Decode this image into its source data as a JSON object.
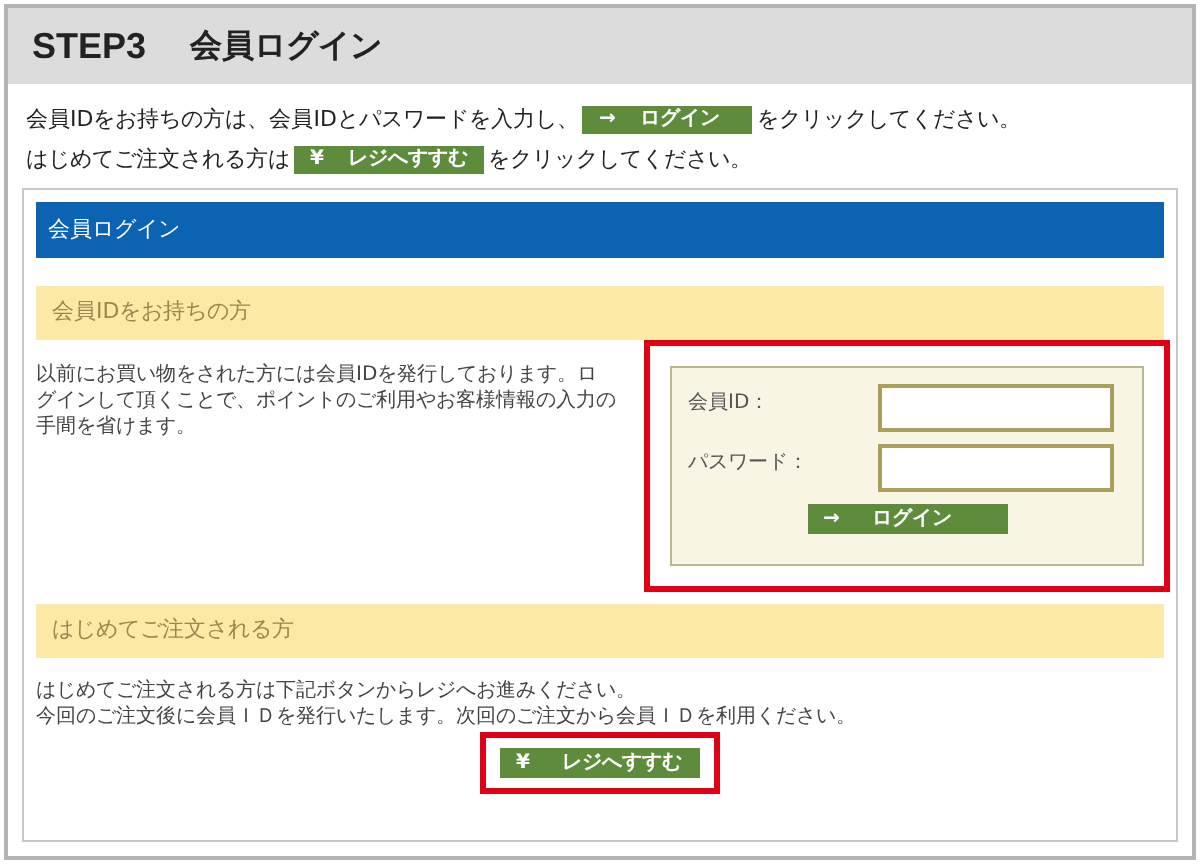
{
  "step": {
    "badge": "STEP3",
    "title": "会員ログイン"
  },
  "intro": [
    {
      "before": "会員IDをお持ちの方は、会員IDとパスワードを入力し、",
      "button": {
        "icon": "→",
        "label": "ログイン"
      },
      "after": "をクリックしてください。"
    },
    {
      "before": "はじめてご注文される方は",
      "button": {
        "icon": "¥",
        "label": "レジへすすむ"
      },
      "after": "をクリックしてください。"
    }
  ],
  "panel": {
    "title": "会員ログイン"
  },
  "member": {
    "heading": "会員IDをお持ちの方",
    "text": "以前にお買い物をされた方には会員IDを発行しております。ログインして頂くことで、ポイントのご利用やお客様情報の入力の手間を省けます。",
    "fields": [
      {
        "label": "会員ID："
      },
      {
        "label": "パスワード："
      }
    ],
    "button": {
      "icon": "→",
      "label": "ログイン"
    }
  },
  "guest": {
    "heading": "はじめてご注文される方",
    "lines": [
      "はじめてご注文される方は下記ボタンからレジへお進みください。",
      "今回のご注文後に会員ＩＤを発行いたします。次回のご注文から会員ＩＤを利用ください。"
    ],
    "button": {
      "icon": "¥",
      "label": "レジへすすむ"
    }
  }
}
